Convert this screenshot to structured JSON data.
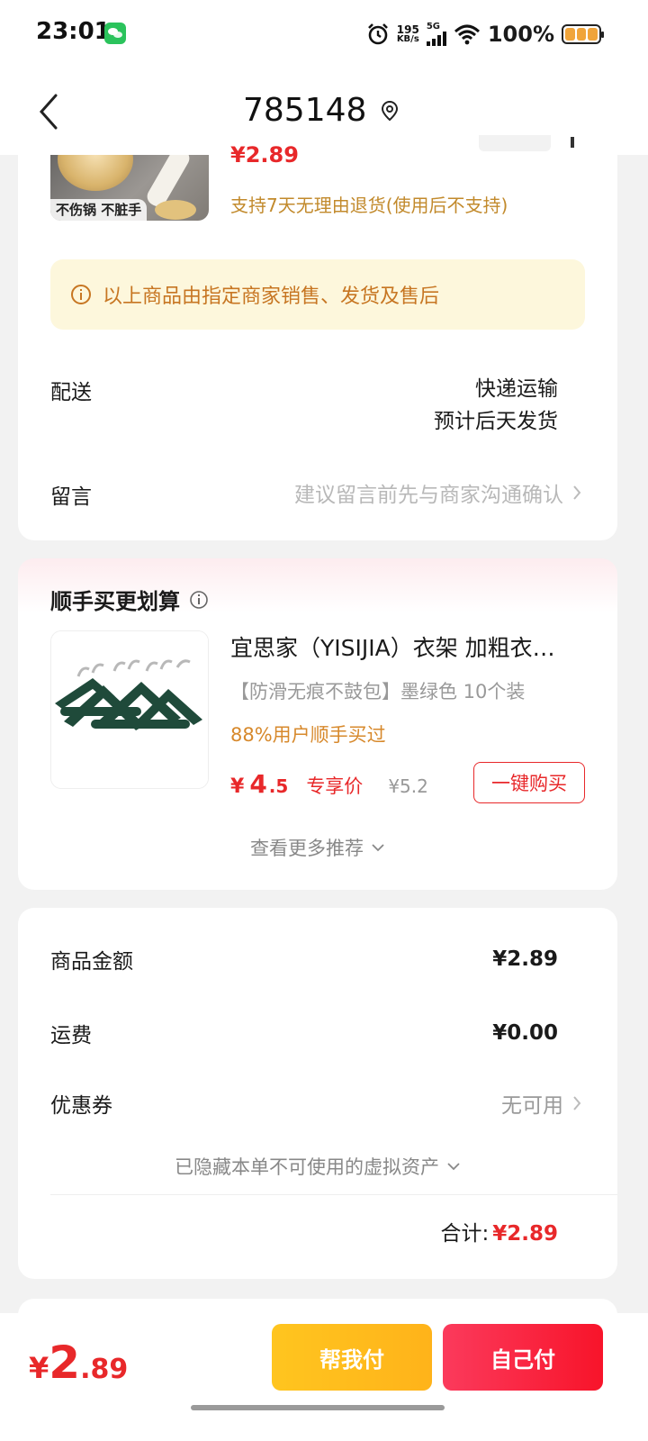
{
  "status_bar": {
    "time": "23:01",
    "net_speed_value": "195",
    "net_speed_unit": "KB/s",
    "network_type": "5G",
    "battery_percent": "100%",
    "icons": [
      "wechat-icon",
      "alarm-icon",
      "signal-icon",
      "wifi-icon",
      "battery-icon"
    ]
  },
  "header": {
    "title": "785148",
    "back_icon": "chevron-left-icon",
    "location_icon": "location-pin-icon"
  },
  "order_item": {
    "image_tag": "不伤锅 不脏手",
    "price": "¥2.89",
    "return_policy": "支持7天无理由退货(使用后不支持)"
  },
  "notice": {
    "text": "以上商品由指定商家销售、发货及售后"
  },
  "delivery": {
    "label": "配送",
    "method": "快递运输",
    "estimate": "预计后天发货"
  },
  "message": {
    "label": "留言",
    "placeholder": "建议留言前先与商家沟通确认"
  },
  "recommend": {
    "title": "顺手买更划算",
    "item": {
      "name": "宜思家（YISIJIA）衣架 加粗衣…",
      "spec": "【防滑无痕不鼓包】墨绿色   10个装",
      "bought_rate": "88%用户顺手买过",
      "currency": "¥",
      "price_int": "4",
      "price_dec": ".5",
      "exclusive_label": "专享价",
      "original_price": "¥5.2",
      "buy_button": "一键购买"
    },
    "more_label": "查看更多推荐"
  },
  "summary": {
    "goods_label": "商品金额",
    "goods_value": "¥2.89",
    "shipping_label": "运费",
    "shipping_value": "¥0.00",
    "coupon_label": "优惠券",
    "coupon_value": "无可用",
    "hidden_assets": "已隐藏本单不可使用的虚拟资产",
    "total_label": "合计:",
    "total_value": "¥2.89"
  },
  "bottom_bar": {
    "currency": "¥",
    "price_int": "2",
    "price_dec": ".89",
    "help_pay_button": "帮我付",
    "self_pay_button": "自己付"
  },
  "colors": {
    "accent_red": "#e8282a",
    "notice_orange": "#c77622",
    "help_yellow": "#ffbb1e"
  }
}
